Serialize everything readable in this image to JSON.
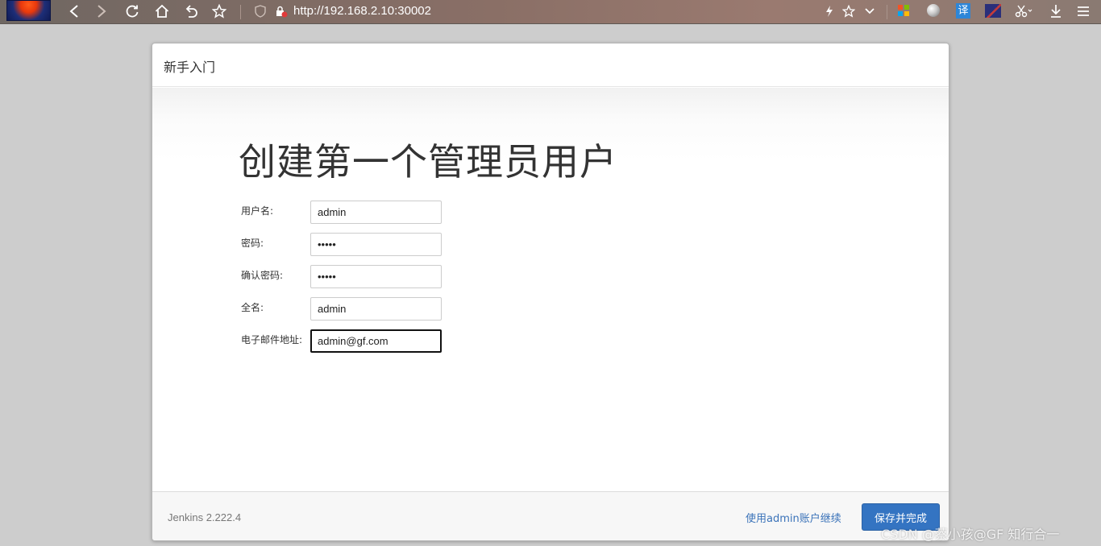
{
  "browser": {
    "url": "http://192.168.2.10:30002",
    "icons": [
      "back-icon",
      "forward-icon",
      "reload-icon",
      "home-icon",
      "undo-icon",
      "bookmark-star-icon",
      "shield-icon",
      "insecure-lock-icon",
      "lightning-icon",
      "star-icon",
      "chevron-down-icon",
      "microsoft-icon",
      "globe-icon",
      "translate-icon",
      "flag-icon",
      "scissors-icon",
      "download-icon",
      "menu-icon"
    ],
    "translate_glyph": "译"
  },
  "card": {
    "header_title": "新手入门",
    "page_title": "创建第一个管理员用户",
    "fields": [
      {
        "label": "用户名:",
        "value": "admin",
        "type": "text"
      },
      {
        "label": "密码:",
        "value": "admin",
        "type": "password"
      },
      {
        "label": "确认密码:",
        "value": "admin",
        "type": "password"
      },
      {
        "label": "全名:",
        "value": "admin",
        "type": "text"
      },
      {
        "label": "电子邮件地址:",
        "value": "admin@gf.com",
        "type": "text",
        "focused": true
      }
    ],
    "footer": {
      "version": "Jenkins 2.222.4",
      "continue_link": "使用admin账户继续",
      "save_button": "保存并完成"
    }
  },
  "watermark": "CSDN @蔡小孩@GF 知行合一",
  "colors": {
    "primary_button": "#3474c2",
    "link": "#3b73b9",
    "page_background": "#cdcdcd"
  }
}
